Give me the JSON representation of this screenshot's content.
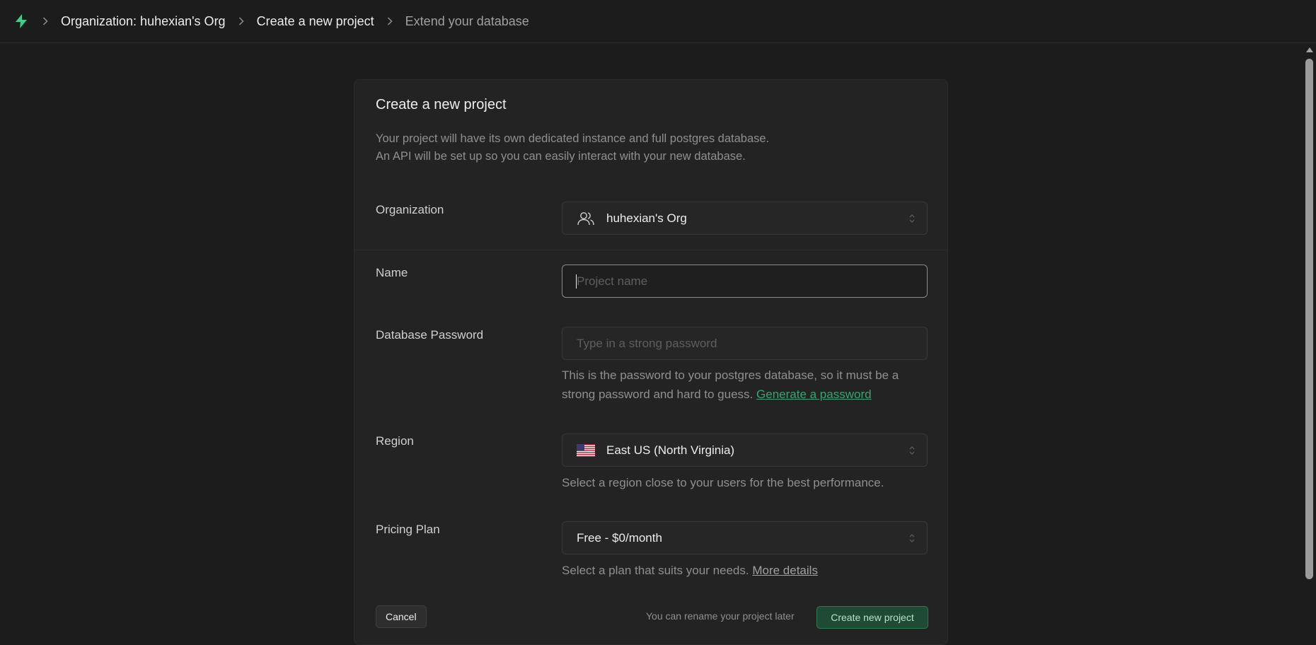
{
  "breadcrumb": {
    "items": [
      {
        "label": "Organization: huhexian's Org"
      },
      {
        "label": "Create a new project"
      },
      {
        "label": "Extend your database"
      }
    ]
  },
  "card": {
    "title": "Create a new project",
    "description_line1": "Your project will have its own dedicated instance and full postgres database.",
    "description_line2": "An API will be set up so you can easily interact with your new database."
  },
  "form": {
    "organization": {
      "label": "Organization",
      "value": "huhexian's Org",
      "icon": "users-icon"
    },
    "name": {
      "label": "Name",
      "value": "",
      "placeholder": "Project name"
    },
    "password": {
      "label": "Database Password",
      "value": "",
      "placeholder": "Type in a strong password",
      "help_line1": "This is the password to your postgres database, so it must be a",
      "help_line2": "strong password and hard to guess.",
      "generate_link": "Generate a password"
    },
    "region": {
      "label": "Region",
      "value": "East US (North Virginia)",
      "flag": "us-flag-icon",
      "help": "Select a region close to your users for the best performance."
    },
    "plan": {
      "label": "Pricing Plan",
      "value": "Free - $0/month",
      "help": "Select a plan that suits your needs.",
      "more_link": "More details"
    }
  },
  "footer": {
    "cancel_label": "Cancel",
    "rename_note": "You can rename your project later",
    "create_label": "Create new project"
  },
  "colors": {
    "background": "#1c1c1c",
    "card": "#232323",
    "brand": "#3ecf8e"
  }
}
